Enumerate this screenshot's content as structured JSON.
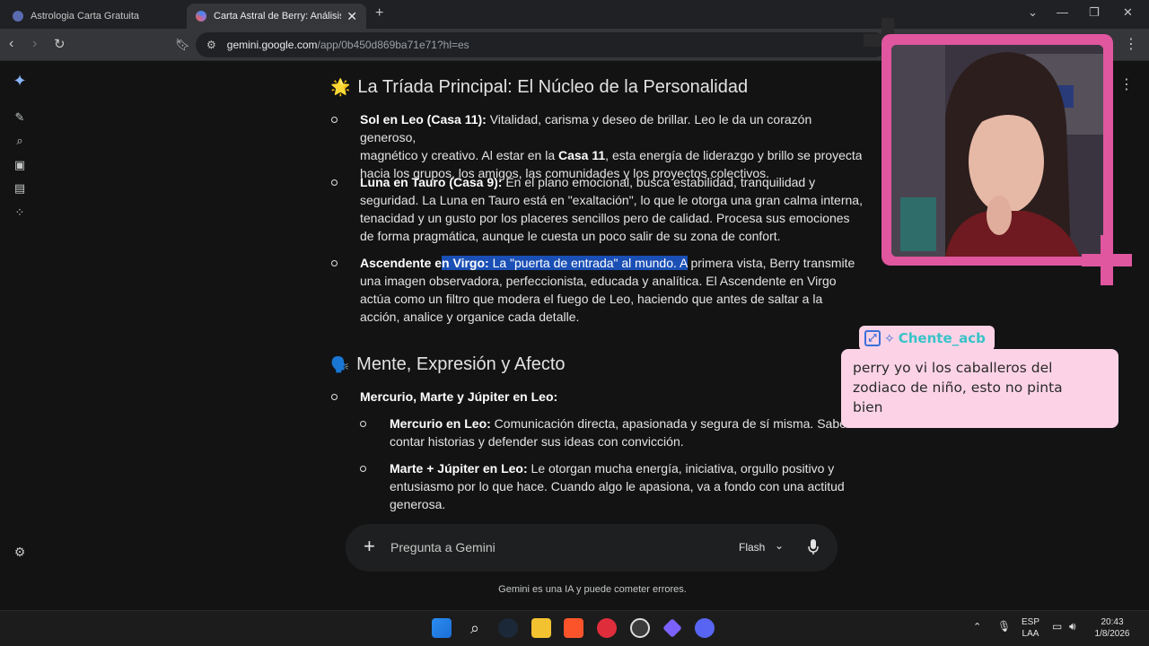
{
  "browser": {
    "tabs": [
      {
        "title": "Astrologia Carta Gratuita",
        "active": false
      },
      {
        "title": "Carta Astral de Berry: Análisis Pr",
        "active": true
      }
    ],
    "url_host": "gemini.google.com",
    "url_path": "/app/0b450d869ba71e71?hl=es"
  },
  "content": {
    "section1": {
      "emoji": "🌟",
      "title": "La Tríada Principal: El Núcleo de la Personalidad",
      "items": [
        {
          "label": "Sol en Leo (Casa 11):",
          "line1": " Vitalidad, carisma y deseo de brillar. Leo le da un corazón generoso,",
          "line2a": "magnético y creativo. Al estar en la ",
          "line2b": "Casa 11",
          "line2c": ", esta energía de liderazgo y brillo se proyecta",
          "line3": "hacia los grupos, los amigos, las comunidades y los proyectos colectivos."
        },
        {
          "label": "Luna en Tauro (Casa 9):",
          "line1": " En el plano emocional, busca estabilidad, tranquilidad y",
          "line2": "seguridad. La Luna en Tauro está en \"exaltación\", lo que le otorga una gran calma interna,",
          "line3": "tenacidad y un gusto por los placeres sencillos pero de calidad. Procesa sus emociones",
          "line4": "de forma pragmática, aunque le cuesta un poco salir de su zona de confort."
        },
        {
          "label_a": "Ascendente e",
          "label_b": "n Virgo:",
          "hl_rest": " La \"puerta de entrada\" al mundo. A",
          "line1_rest": " primera vista, Berry transmite",
          "line2": "una imagen observadora, perfeccionista, educada y analítica. El Ascendente en Virgo",
          "line3": "actúa como un filtro que modera el fuego de Leo, haciendo que antes de saltar a la",
          "line4": "acción, analice y organice cada detalle."
        }
      ]
    },
    "section2": {
      "emoji": "🗣️",
      "title": "Mente, Expresión y Afecto",
      "item_label": "Mercurio, Marte y Júpiter en Leo:",
      "subitems": [
        {
          "label": "Mercurio en Leo:",
          "line1": " Comunicación directa, apasionada y segura de sí misma. Sabe",
          "line2": "contar historias y defender sus ideas con convicción."
        },
        {
          "label": "Marte + Júpiter en Leo:",
          "line1": " Le otorgan mucha energía, iniciativa, orgullo positivo y",
          "line2": "entusiasmo por lo que hace. Cuando algo le apasiona, va a fondo con una actitud",
          "line3": "generosa."
        }
      ]
    }
  },
  "input": {
    "placeholder": "Pregunta a Gemini",
    "model": "Flash"
  },
  "disclaimer": "Gemini es una IA y puede cometer errores.",
  "chat": {
    "username": "Chente_acb",
    "message_line1": "perry yo vi los caballeros del",
    "message_line2": "zodiaco de niño, esto no pinta",
    "message_line3": "bien"
  },
  "taskbar": {
    "lang1": "ESP",
    "lang2": "LAA",
    "time": "20:43",
    "date": "1/8/2026"
  },
  "colors": {
    "accent_pink": "#e0569f",
    "chat_bg": "#fcd3e6",
    "username": "#38c3c8",
    "highlight": "#1a4fb5"
  }
}
